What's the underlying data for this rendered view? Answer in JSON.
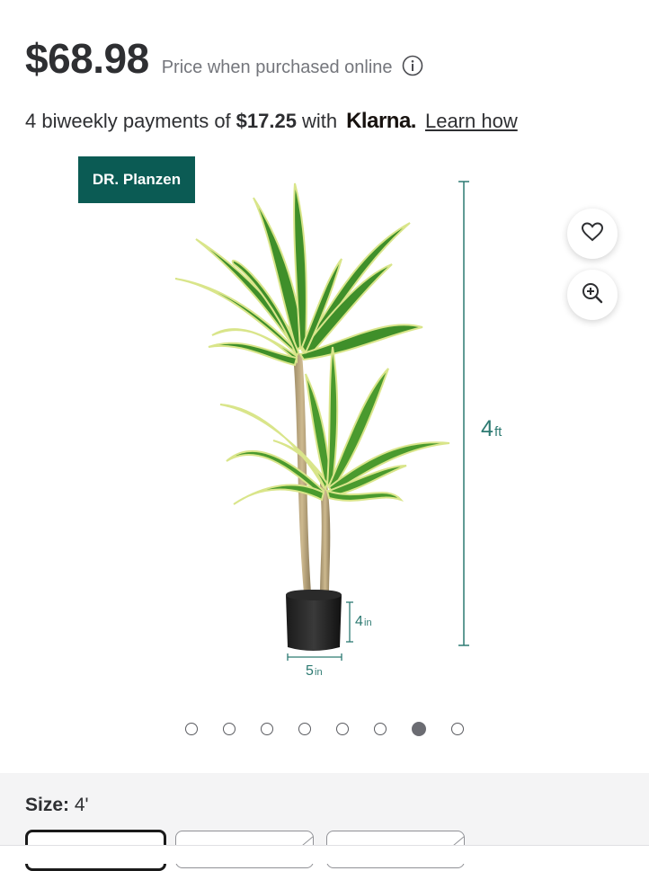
{
  "price": {
    "amount": "$68.98",
    "note": "Price when purchased online",
    "info_icon": "info-circle-icon"
  },
  "klarna": {
    "prefix": "4 biweekly payments of",
    "amount": "$17.25",
    "with": "with",
    "brand": "Klarna.",
    "link": "Learn how"
  },
  "product_image": {
    "brand_badge": "DR. Planzen",
    "height_label_num": "4",
    "height_label_unit": "ft",
    "pot_height_num": "4",
    "pot_height_unit": "in",
    "pot_width_num": "5",
    "pot_width_unit": "in",
    "dimension_color": "#2d7a72"
  },
  "actions": {
    "favorite_icon": "heart-icon",
    "zoom_icon": "zoom-in-icon"
  },
  "carousel": {
    "total": 8,
    "active_index": 6
  },
  "size": {
    "label": "Size:",
    "value": "4'"
  }
}
